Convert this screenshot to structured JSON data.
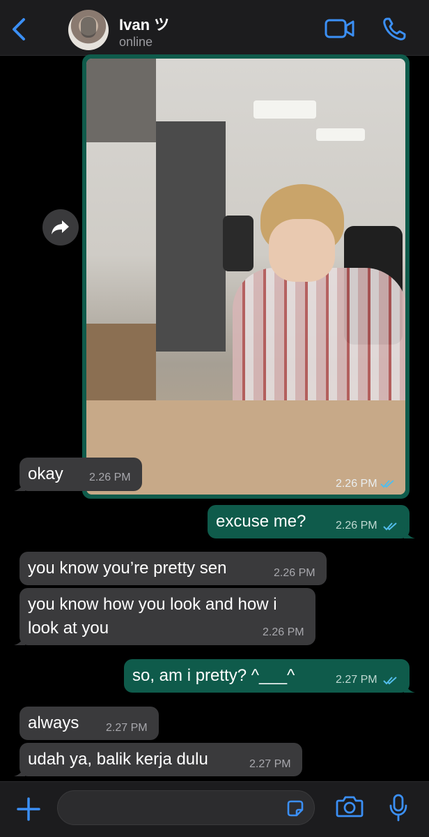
{
  "header": {
    "contact_name": "Ivan ツ",
    "status": "online"
  },
  "colors": {
    "accent": "#3b8ff5",
    "outgoing_bubble": "#0f5b4b",
    "incoming_bubble": "#3a3a3c",
    "header_bg": "#1c1c1e"
  },
  "messages": {
    "m0": {
      "direction": "out",
      "type": "image",
      "time": "2.26 PM",
      "read": true
    },
    "m1": {
      "direction": "in",
      "text": "okay",
      "time": "2.26 PM"
    },
    "m2": {
      "direction": "out",
      "text": "excuse me?",
      "time": "2.26 PM",
      "read": true
    },
    "m3": {
      "direction": "in",
      "text": "you know you’re pretty sen",
      "time": "2.26 PM"
    },
    "m4": {
      "direction": "in",
      "line1": "you know how you look and how i",
      "line2": "look at you",
      "time": "2.26 PM"
    },
    "m5": {
      "direction": "out",
      "text": "so, am i pretty? ^___^",
      "time": "2.27 PM",
      "read": true
    },
    "m6": {
      "direction": "in",
      "text": "always",
      "time": "2.27 PM"
    },
    "m7": {
      "direction": "in",
      "text": "udah ya, balik kerja dulu",
      "time": "2.27 PM"
    }
  },
  "icons": {
    "back": "chevron-left-icon",
    "video": "video-camera-icon",
    "call": "phone-icon",
    "forward": "forward-arrow-icon",
    "attach": "plus-icon",
    "sticker": "sticker-icon",
    "camera": "camera-icon",
    "mic": "microphone-icon"
  }
}
